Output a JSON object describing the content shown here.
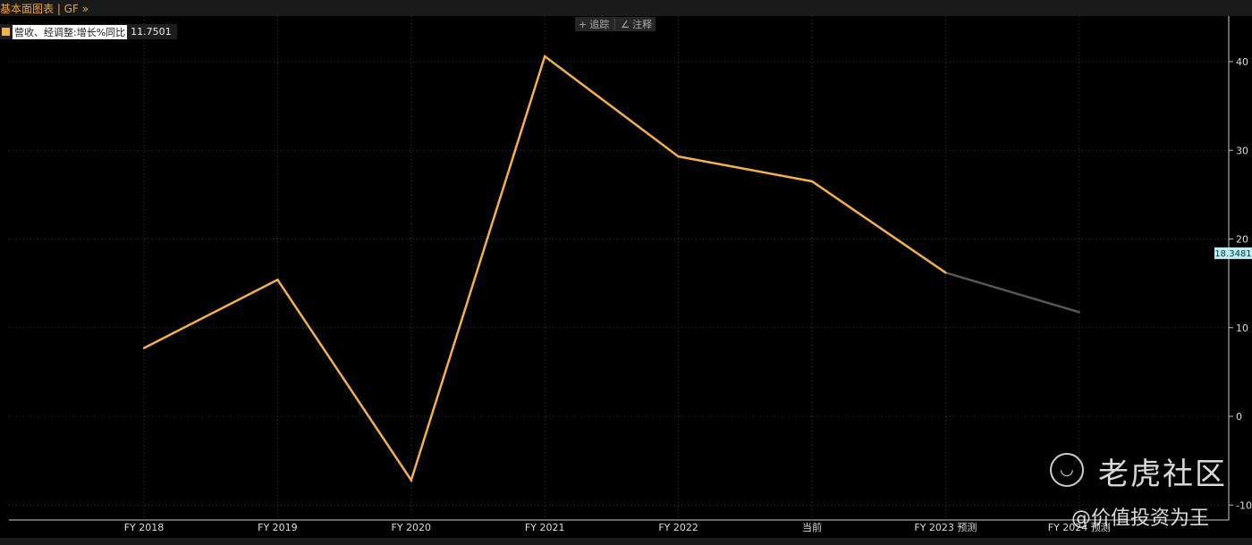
{
  "header": {
    "title": "基本面图表 | GF »"
  },
  "toolbar": {
    "track_label": "追踪",
    "note_label": "注释"
  },
  "legend": {
    "series_label": "营收、经调整:增长%同比",
    "current_value": "11.7501",
    "color": "#f5b04a"
  },
  "chart_data": {
    "type": "line",
    "categories": [
      "FY 2018",
      "FY 2019",
      "FY 2020",
      "FY 2021",
      "FY 2022",
      "当前",
      "FY 2023 预测",
      "FY 2024 预测"
    ],
    "x_labels": [
      {
        "text": "FY 2018",
        "highlight": false
      },
      {
        "text": "FY 2019",
        "highlight": false
      },
      {
        "text": "FY 2020",
        "highlight": false
      },
      {
        "text": "FY 2021",
        "highlight": false
      },
      {
        "text": "FY 2022",
        "highlight": false
      },
      {
        "text": "当前",
        "highlight": false
      },
      {
        "text": "FY 2023 预测",
        "highlight": true
      },
      {
        "text": "FY 2024 预测",
        "highlight": false
      }
    ],
    "series": [
      {
        "name": "营收、经调整:增长%同比",
        "values": [
          7.7,
          15.4,
          -7.2,
          40.6,
          29.3,
          26.5,
          16.2,
          11.7501
        ],
        "color": "#f5b04a",
        "forecast_color": "#5a5550",
        "forecast_from_index": 6
      }
    ],
    "y_ticks": [
      40,
      30,
      20,
      10,
      0,
      -10
    ],
    "y_tick_labels": [
      "40",
      "30",
      "20",
      "10",
      "0",
      "-10"
    ],
    "ylim": [
      -10,
      40
    ],
    "y_axis_marker": {
      "label": "18.3481",
      "value": 18.3481
    },
    "grid": true,
    "legend_position": "top-left"
  },
  "watermark": {
    "logo_icon": "tiger-icon",
    "name": "老虎社区",
    "handle": "@价值投资为王"
  }
}
